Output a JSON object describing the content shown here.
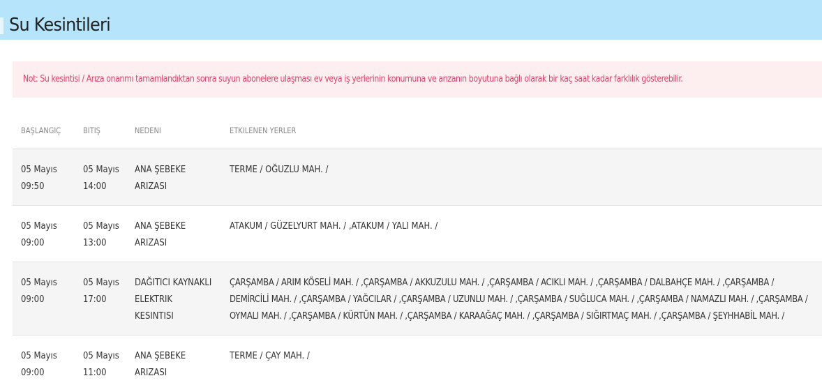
{
  "page": {
    "title": "Su Kesintileri"
  },
  "notice": {
    "text": "Not: Su kesintisi / Arıza onarımı tamamlandıktan sonra suyun abonelere ulaşması ev veya iş yerlerinin konumuna ve arızanın boyutuna bağlı olarak bir kaç saat kadar farklılık gösterebilir."
  },
  "table": {
    "headers": {
      "start": "BAŞLANGIÇ",
      "end": "BITIŞ",
      "reason": "NEDENI",
      "places": "ETKILENEN YERLER"
    },
    "rows": [
      {
        "start_date": "05 Mayıs",
        "start_time": "09:50",
        "end_date": "05 Mayıs",
        "end_time": "14:00",
        "reason_lines": [
          "ANA ŞEBEKE",
          "ARIZASI"
        ],
        "places": "TERME / OĞUZLU MAH. /"
      },
      {
        "start_date": "05 Mayıs",
        "start_time": "09:00",
        "end_date": "05 Mayıs",
        "end_time": "13:00",
        "reason_lines": [
          "ANA ŞEBEKE",
          "ARIZASI"
        ],
        "places": "ATAKUM / GÜZELYURT MAH. / ,ATAKUM / YALI MAH. /"
      },
      {
        "start_date": "05 Mayıs",
        "start_time": "09:00",
        "end_date": "05 Mayıs",
        "end_time": "17:00",
        "reason_lines": [
          "DAĞITICI KAYNAKLI",
          "ELEKTRIK",
          "KESINTISI"
        ],
        "places": "ÇARŞAMBA / ARIM KÖSELİ MAH. / ,ÇARŞAMBA / AKKUZULU MAH. / ,ÇARŞAMBA / ACIKLI MAH. / ,ÇARŞAMBA / DALBAHÇE MAH. / ,ÇARŞAMBA / DEMİRCİLİ MAH. / ,ÇARŞAMBA / YAĞCILAR / ,ÇARŞAMBA / UZUNLU MAH. / ,ÇARŞAMBA / SUĞLUCA MAH. / ,ÇARŞAMBA / NAMAZLI MAH. / ,ÇARŞAMBA / OYMALI MAH. / ,ÇARŞAMBA / KÜRTÜN MAH. / ,ÇARŞAMBA / KARAAĞAÇ MAH. / ,ÇARŞAMBA / SIĞIRTMAÇ MAH. / ,ÇARŞAMBA / ŞEYHHABİL MAH. /"
      },
      {
        "start_date": "05 Mayıs",
        "start_time": "09:00",
        "end_date": "05 Mayıs",
        "end_time": "11:00",
        "reason_lines": [
          "ANA ŞEBEKE",
          "ARIZASI"
        ],
        "places": "TERME / ÇAY MAH. /"
      }
    ]
  },
  "colors": {
    "header_bg": "#b5e4fb",
    "notice_bg": "#fdeff0",
    "notice_text": "#e0426a",
    "row_shade": "#f5f5f5"
  }
}
